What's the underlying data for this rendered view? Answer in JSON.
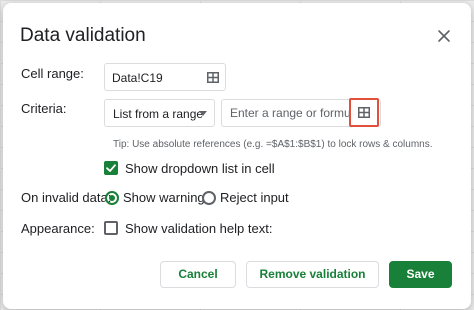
{
  "dialog": {
    "title": "Data validation",
    "close_icon": "close-icon"
  },
  "cell_range": {
    "label": "Cell range:",
    "value": "Data!C19",
    "icon": "grid-icon"
  },
  "criteria": {
    "label": "Criteria:",
    "selected": "List from a range",
    "caret_icon": "caret-down-icon",
    "range_placeholder": "Enter a range or formula",
    "range_value": "",
    "range_icon": "grid-icon",
    "tip": "Tip: Use absolute references (e.g. =$A$1:$B$1) to lock rows & columns.",
    "show_dropdown_label": "Show dropdown list in cell",
    "show_dropdown_checked": true
  },
  "invalid_data": {
    "label": "On invalid data:",
    "options": [
      {
        "label": "Show warning",
        "selected": true
      },
      {
        "label": "Reject input",
        "selected": false
      }
    ]
  },
  "appearance": {
    "label": "Appearance:",
    "help_text_label": "Show validation help text:",
    "help_text_checked": false
  },
  "footer": {
    "cancel_label": "Cancel",
    "remove_label": "Remove validation",
    "save_label": "Save"
  },
  "colors": {
    "accent": "#188038",
    "highlight": "#e0503a"
  }
}
